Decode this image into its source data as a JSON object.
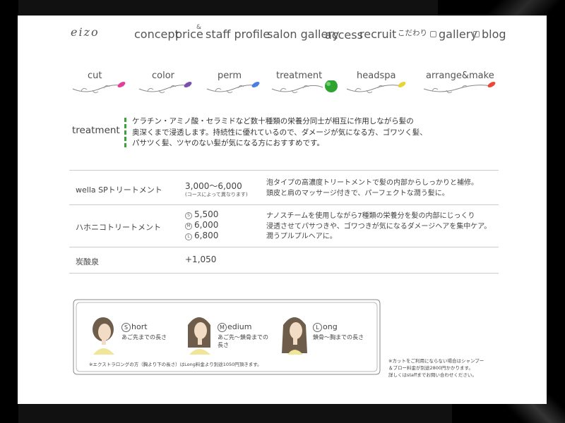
{
  "site": {
    "logo": "eizo"
  },
  "nav": {
    "items": [
      "concept",
      "price",
      "staff profile",
      "salon gallery",
      "access",
      "recruit",
      "こだわり",
      "gallery",
      "blog"
    ],
    "price_mark": "&"
  },
  "menu": {
    "items": [
      "cut",
      "color",
      "perm",
      "treatment",
      "headspa",
      "arrange&make"
    ],
    "colors": [
      "#e0409a",
      "#7a4fb0",
      "#4a7fe0",
      "#2fa32f",
      "#e8d43a",
      "#e84a3a"
    ]
  },
  "section": {
    "title": "treatment",
    "intro": [
      "ケラチン・アミノ酸・セラミドなど数十種類の栄養分同士が相互に作用しながら髪の",
      "奥深くまで浸透します。持続性に優れているので、ダメージが気になる方、ゴワツく髪、",
      "パサツく髪、ツヤのない髪が気になる方におすすめです。"
    ]
  },
  "table": {
    "rows": [
      {
        "name": "wella SPトリートメント",
        "price": "3,000〜6,000",
        "price_note": "(コースによって異なります)",
        "desc": [
          "泡タイプの高濃度トリートメントで髪の内部からしっかりと補修。",
          "頭皮と肩のマッサージ付きで、パーフェクトな潤う髪に。"
        ]
      },
      {
        "name": "ハホニコトリートメント",
        "prices": [
          {
            "size": "S",
            "value": "5,500"
          },
          {
            "size": "M",
            "value": "6,000"
          },
          {
            "size": "L",
            "value": "6,800"
          }
        ],
        "desc": [
          "ナノスチームを使用しながら7種類の栄養分を髪の内部にじっくり",
          "浸透させてパサつきや、ゴワつきが気になるダメージヘアを集中ケア。",
          "潤うプルプルヘアに。"
        ]
      },
      {
        "name": "炭酸泉",
        "price": "+1,050"
      }
    ]
  },
  "lengths": {
    "items": [
      {
        "letter": "S",
        "rest": "hort",
        "desc": "あご先までの長さ"
      },
      {
        "letter": "M",
        "rest": "edium",
        "desc": "あご先〜鎖骨までの長さ"
      },
      {
        "letter": "L",
        "rest": "ong",
        "desc": "鎖骨〜胸までの長さ"
      }
    ],
    "note": "※エクストラロングの方（胸より下の長さ）はLong料金より別途1050円頂きます。"
  },
  "side_note": [
    "※カットをご利用にならない場合はシャンプー",
    "＆ブロー料金が別途2800円かかります。",
    "詳しくはstaffまでお問い合わせください。"
  ]
}
